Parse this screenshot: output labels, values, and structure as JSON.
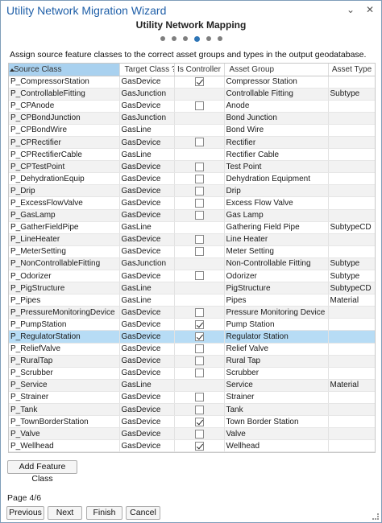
{
  "window": {
    "title": "Utility Network Migration Wizard",
    "pin_glyph": "⌄",
    "close_glyph": "✕"
  },
  "page": {
    "heading": "Utility Network Mapping",
    "step_total": 6,
    "step_current": 4,
    "instruction": "Assign source feature classes to the correct asset groups and types in the output geodatabase."
  },
  "table": {
    "columns": [
      "Source Class",
      "Target Class ?",
      "Is Controller",
      "Asset Group",
      "Asset Type"
    ],
    "sorted_column": "Source Class",
    "rows": [
      {
        "source": "P_CompressorStation",
        "target": "GasDevice",
        "controller": true,
        "group": "Compressor Station",
        "type": ""
      },
      {
        "source": "P_ControllableFitting",
        "target": "GasJunction",
        "controller": null,
        "group": "Controllable Fitting",
        "type": "Subtype"
      },
      {
        "source": "P_CPAnode",
        "target": "GasDevice",
        "controller": false,
        "group": "Anode",
        "type": ""
      },
      {
        "source": "P_CPBondJunction",
        "target": "GasJunction",
        "controller": null,
        "group": "Bond Junction",
        "type": ""
      },
      {
        "source": "P_CPBondWire",
        "target": "GasLine",
        "controller": null,
        "group": "Bond Wire",
        "type": ""
      },
      {
        "source": "P_CPRectifier",
        "target": "GasDevice",
        "controller": false,
        "group": "Rectifier",
        "type": ""
      },
      {
        "source": "P_CPRectifierCable",
        "target": "GasLine",
        "controller": null,
        "group": "Rectifier Cable",
        "type": ""
      },
      {
        "source": "P_CPTestPoint",
        "target": "GasDevice",
        "controller": false,
        "group": "Test Point",
        "type": ""
      },
      {
        "source": "P_DehydrationEquip",
        "target": "GasDevice",
        "controller": false,
        "group": "Dehydration Equipment",
        "type": ""
      },
      {
        "source": "P_Drip",
        "target": "GasDevice",
        "controller": false,
        "group": "Drip",
        "type": ""
      },
      {
        "source": "P_ExcessFlowValve",
        "target": "GasDevice",
        "controller": false,
        "group": "Excess Flow Valve",
        "type": ""
      },
      {
        "source": "P_GasLamp",
        "target": "GasDevice",
        "controller": false,
        "group": "Gas Lamp",
        "type": ""
      },
      {
        "source": "P_GatherFieldPipe",
        "target": "GasLine",
        "controller": null,
        "group": "Gathering Field Pipe",
        "type": "SubtypeCD"
      },
      {
        "source": "P_LineHeater",
        "target": "GasDevice",
        "controller": false,
        "group": "Line Heater",
        "type": ""
      },
      {
        "source": "P_MeterSetting",
        "target": "GasDevice",
        "controller": false,
        "group": "Meter Setting",
        "type": ""
      },
      {
        "source": "P_NonControllableFitting",
        "target": "GasJunction",
        "controller": null,
        "group": "Non-Controllable Fitting",
        "type": "Subtype"
      },
      {
        "source": "P_Odorizer",
        "target": "GasDevice",
        "controller": false,
        "group": "Odorizer",
        "type": "Subtype"
      },
      {
        "source": "P_PigStructure",
        "target": "GasLine",
        "controller": null,
        "group": "PigStructure",
        "type": "SubtypeCD"
      },
      {
        "source": "P_Pipes",
        "target": "GasLine",
        "controller": null,
        "group": "Pipes",
        "type": "Material"
      },
      {
        "source": "P_PressureMonitoringDevice",
        "target": "GasDevice",
        "controller": false,
        "group": "Pressure Monitoring Device",
        "type": ""
      },
      {
        "source": "P_PumpStation",
        "target": "GasDevice",
        "controller": true,
        "group": "Pump Station",
        "type": ""
      },
      {
        "source": "P_RegulatorStation",
        "target": "GasDevice",
        "controller": true,
        "group": "Regulator Station",
        "type": ""
      },
      {
        "source": "P_ReliefValve",
        "target": "GasDevice",
        "controller": false,
        "group": "Relief Valve",
        "type": ""
      },
      {
        "source": "P_RuralTap",
        "target": "GasDevice",
        "controller": false,
        "group": "Rural Tap",
        "type": ""
      },
      {
        "source": "P_Scrubber",
        "target": "GasDevice",
        "controller": false,
        "group": "Scrubber",
        "type": ""
      },
      {
        "source": "P_Service",
        "target": "GasLine",
        "controller": null,
        "group": "Service",
        "type": "Material"
      },
      {
        "source": "P_Strainer",
        "target": "GasDevice",
        "controller": false,
        "group": "Strainer",
        "type": ""
      },
      {
        "source": "P_Tank",
        "target": "GasDevice",
        "controller": false,
        "group": "Tank",
        "type": ""
      },
      {
        "source": "P_TownBorderStation",
        "target": "GasDevice",
        "controller": true,
        "group": "Town Border Station",
        "type": ""
      },
      {
        "source": "P_Valve",
        "target": "GasDevice",
        "controller": false,
        "group": "Valve",
        "type": ""
      },
      {
        "source": "P_Wellhead",
        "target": "GasDevice",
        "controller": true,
        "group": "Wellhead",
        "type": ""
      }
    ],
    "selected_row": "P_RegulatorStation"
  },
  "buttons": {
    "add_feature_class": "Add Feature Class",
    "previous": "Previous",
    "next": "Next",
    "finish": "Finish",
    "cancel": "Cancel"
  },
  "footer": {
    "page_indicator": "Page 4/6"
  },
  "colors": {
    "title": "#1f5fa8",
    "accent": "#2e75b6",
    "selected_row": "#b7dcf5",
    "sorted_header": "#a9d1ef"
  }
}
